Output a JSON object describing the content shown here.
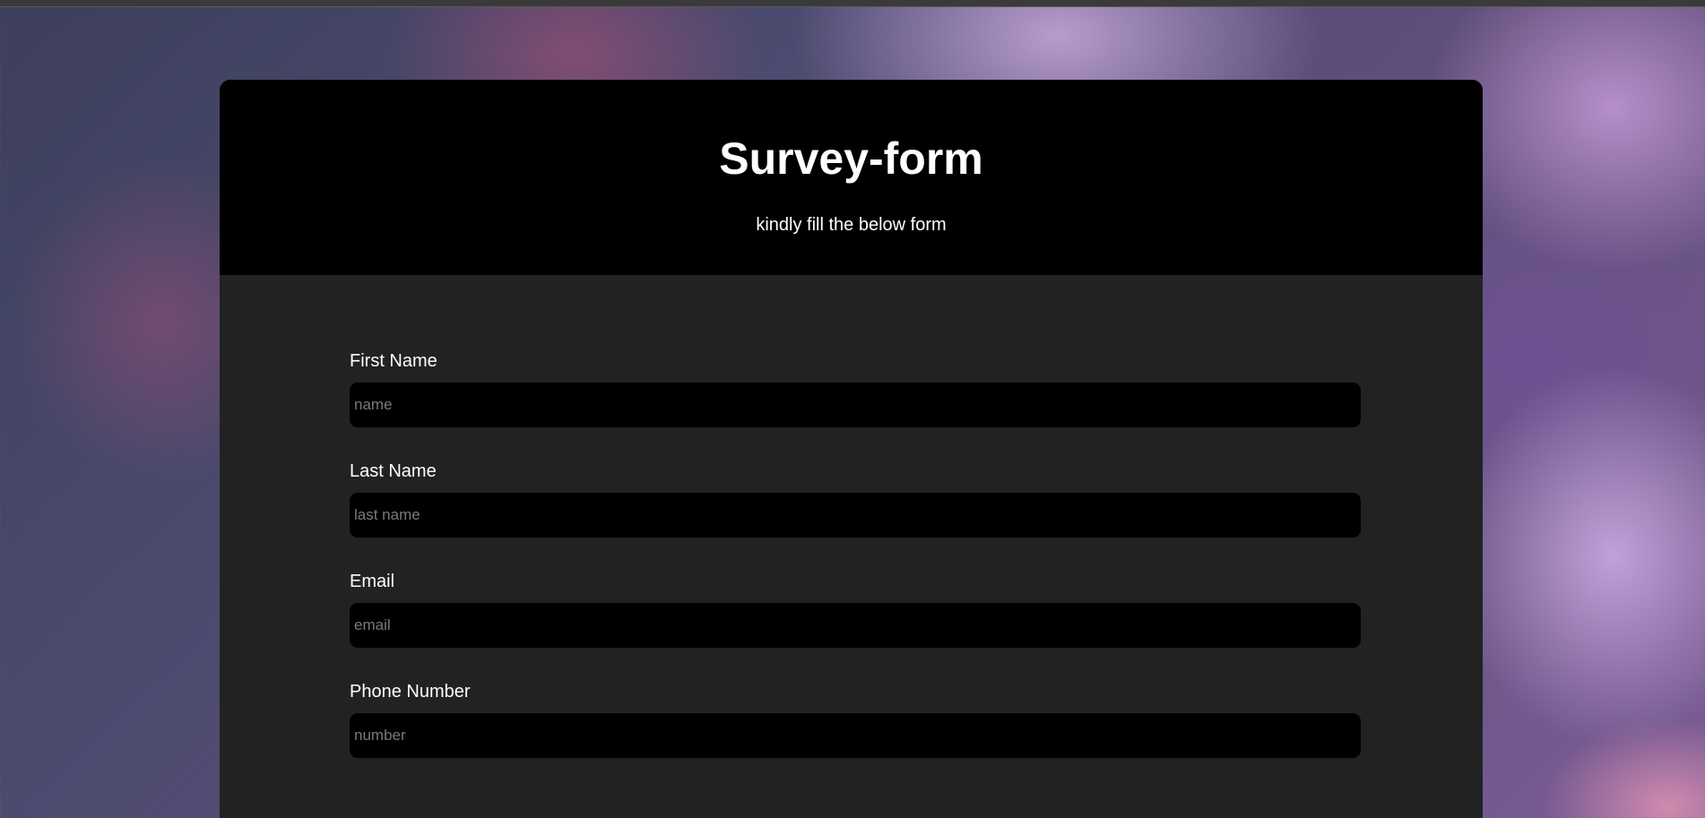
{
  "header": {
    "title": "Survey-form",
    "subtitle": "kindly fill the below form"
  },
  "form": {
    "fields": [
      {
        "label": "First Name",
        "placeholder": "name",
        "value": ""
      },
      {
        "label": "Last Name",
        "placeholder": "last name",
        "value": ""
      },
      {
        "label": "Email",
        "placeholder": "email",
        "value": ""
      },
      {
        "label": "Phone Number",
        "placeholder": "number",
        "value": ""
      }
    ]
  },
  "colors": {
    "header_bg": "#000000",
    "card_bg": "#222222",
    "input_bg": "#000000",
    "text": "#ffffff",
    "placeholder": "#7a7a7a"
  }
}
